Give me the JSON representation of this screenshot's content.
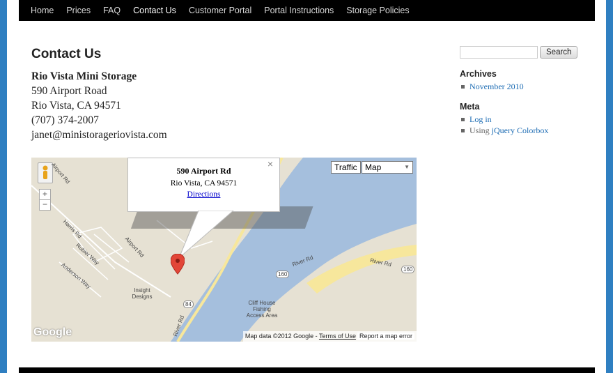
{
  "nav": {
    "items": [
      "Home",
      "Prices",
      "FAQ",
      "Contact Us",
      "Customer Portal",
      "Portal Instructions",
      "Storage Policies"
    ],
    "current": "Contact Us"
  },
  "page": {
    "title": "Contact Us",
    "business_name": "Rio Vista Mini Storage",
    "street": "590 Airport Road",
    "city_state_zip": "Rio Vista, CA 94571",
    "phone": "(707) 374-2007",
    "email": "janet@ministorageriovista.com"
  },
  "map": {
    "info_window": {
      "title": "590 Airport Rd",
      "city": "Rio Vista, CA 94571",
      "directions_link": "Directions",
      "close": "×"
    },
    "controls": {
      "zoom_in": "+",
      "zoom_out": "−",
      "traffic": "Traffic",
      "map_type": "Map"
    },
    "labels": {
      "airport_rd_1": "Airport Rd",
      "airport_rd_2": "Airport Rd",
      "harris_rd": "Harris Rd",
      "rubier_way": "Rubier Way",
      "anderson_way": "Anderson Way",
      "insight_designs": "Insight Designs",
      "river_rd_1": "River Rd",
      "river_rd_2": "River Rd",
      "river_rd_3": "River Rd",
      "cliff_house": "Cliff House Fishing Access Area",
      "hwy_84": "84",
      "hwy_160_a": "160",
      "hwy_160_b": "160"
    },
    "attribution": "Map data ©2012 Google - ",
    "terms_link": "Terms of Use",
    "report_link": "Report a map error",
    "logo": "Google",
    "colors": {
      "land": "#e6e1d3",
      "water": "#a5bfdd",
      "road_major": "#f7e79c"
    }
  },
  "sidebar": {
    "search_button": "Search",
    "search_placeholder": "",
    "archives_title": "Archives",
    "archives": [
      "November 2010"
    ],
    "meta_title": "Meta",
    "meta_login": "Log in",
    "meta_using": "Using ",
    "meta_colorbox": "jQuery Colorbox"
  },
  "colors": {
    "background": "#2f7fc1",
    "nav_bg": "#000000",
    "link": "#1b6bb3"
  }
}
